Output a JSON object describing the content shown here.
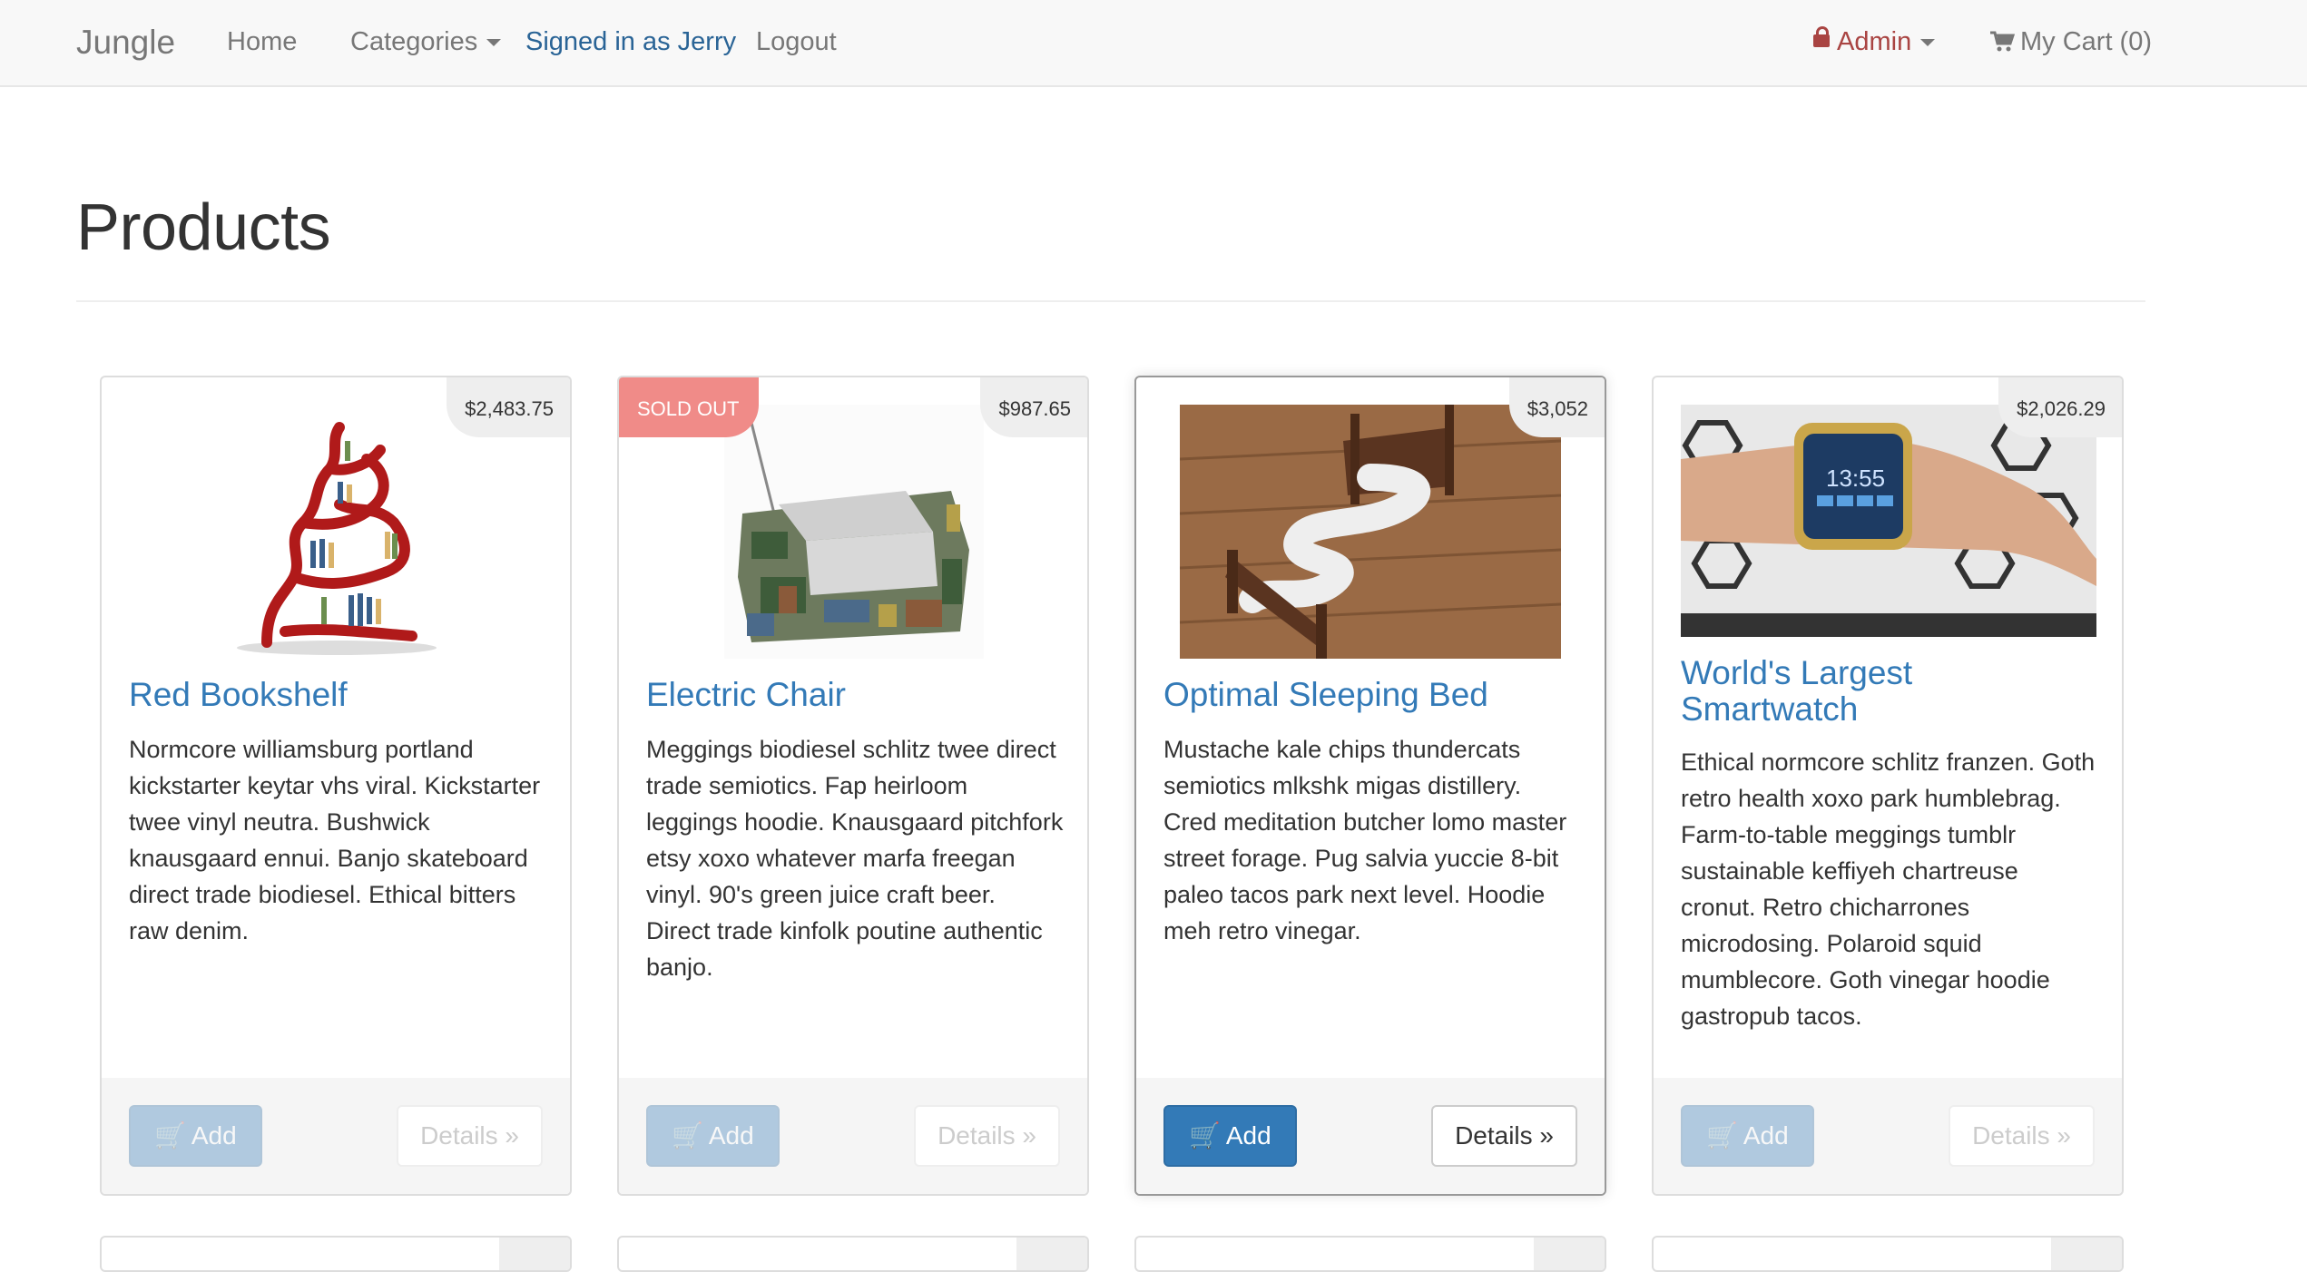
{
  "navbar": {
    "brand": "Jungle",
    "home": "Home",
    "categories": "Categories",
    "signed_in": "Signed in as Jerry",
    "logout": "Logout",
    "admin": "Admin",
    "cart": "My Cart (0)",
    "icons": {
      "admin": "lock-icon",
      "cart": "shopping-cart-icon"
    },
    "colors": {
      "signed_in": "#2a6496",
      "admin": "#a94442"
    }
  },
  "page": {
    "title": "Products"
  },
  "products": [
    {
      "name": "Red Bookshelf",
      "price": "$2,483.75",
      "sold_out": false,
      "description": "Normcore williamsburg portland kickstarter keytar vhs viral. Kickstarter twee vinyl neutra. Bushwick knausgaard ennui. Banjo skateboard direct trade biodiesel. Ethical bitters raw denim.",
      "add_label": "Add",
      "details_label": "Details »"
    },
    {
      "name": "Electric Chair",
      "price": "$987.65",
      "sold_out": true,
      "sold_out_label": "SOLD OUT",
      "description": "Meggings biodiesel schlitz twee direct trade semiotics. Fap heirloom leggings hoodie. Knausgaard pitchfork etsy xoxo whatever marfa freegan vinyl. 90's green juice craft beer. Direct trade kinfolk poutine authentic banjo.",
      "add_label": "Add",
      "details_label": "Details »"
    },
    {
      "name": "Optimal Sleeping Bed",
      "price": "$3,052",
      "sold_out": false,
      "description": "Mustache kale chips thundercats semiotics mlkshk migas distillery. Cred meditation butcher lomo master street forage. Pug salvia yuccie 8-bit paleo tacos park next level. Hoodie meh retro vinegar.",
      "add_label": "Add",
      "details_label": "Details »"
    },
    {
      "name": "World's Largest Smartwatch",
      "price": "$2,026.29",
      "sold_out": false,
      "description": "Ethical normcore schlitz franzen. Goth retro health xoxo park humblebrag. Farm-to-table meggings tumblr sustainable keffiyeh chartreuse cronut. Retro chicharrones microdosing. Polaroid squid mumblecore. Goth vinegar hoodie gastropub tacos.",
      "add_label": "Add",
      "details_label": "Details »",
      "image_text": "13:55"
    }
  ]
}
